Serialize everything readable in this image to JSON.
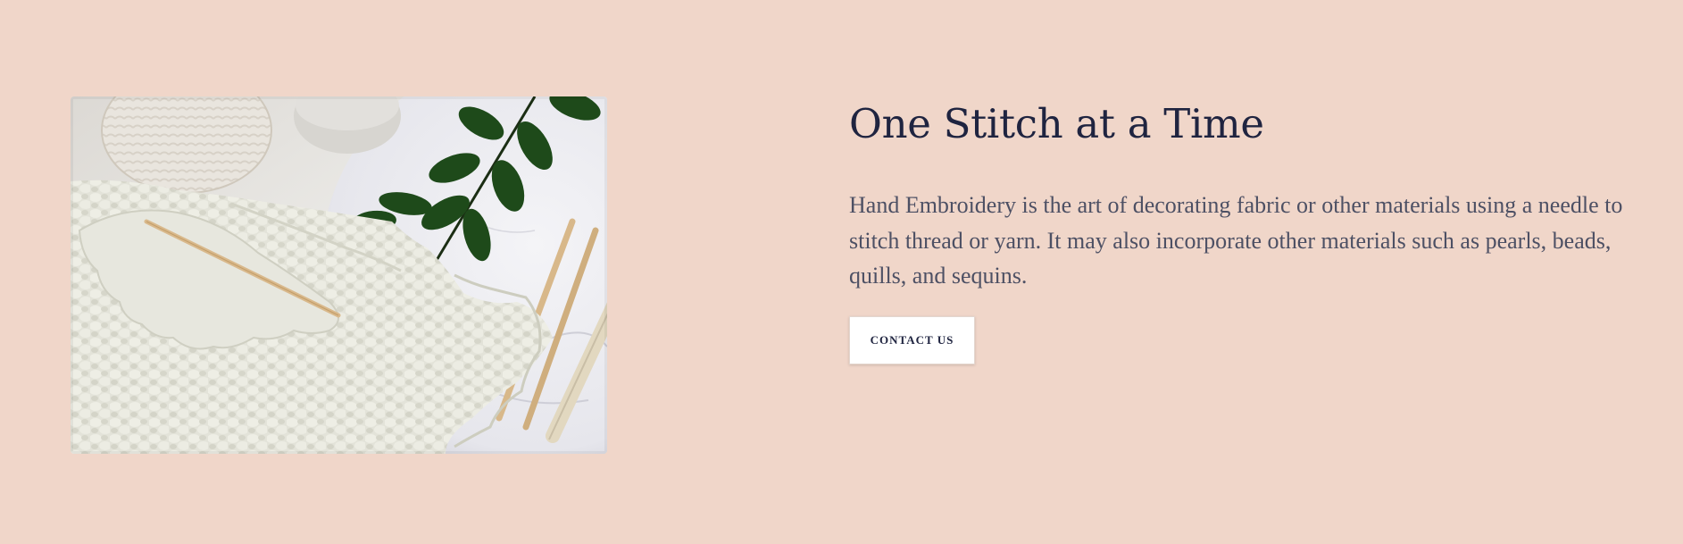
{
  "colors": {
    "background": "#f0d6c9",
    "heading": "#1f2440",
    "body_text": "#4d5064",
    "button_bg": "#ffffff"
  },
  "feature": {
    "image": {
      "alt": "Cream crochet blanket with a wooden crochet hook, yarn ball, marble plate and green leaves",
      "icon": "photo-image"
    },
    "title": "One Stitch at a Time",
    "description": "Hand Embroidery is the art of decorating fabric or other materials using a needle to stitch thread or yarn. It may also incorporate other materials such as pearls, beads, quills, and sequins.",
    "cta_label": "CONTACT US"
  }
}
